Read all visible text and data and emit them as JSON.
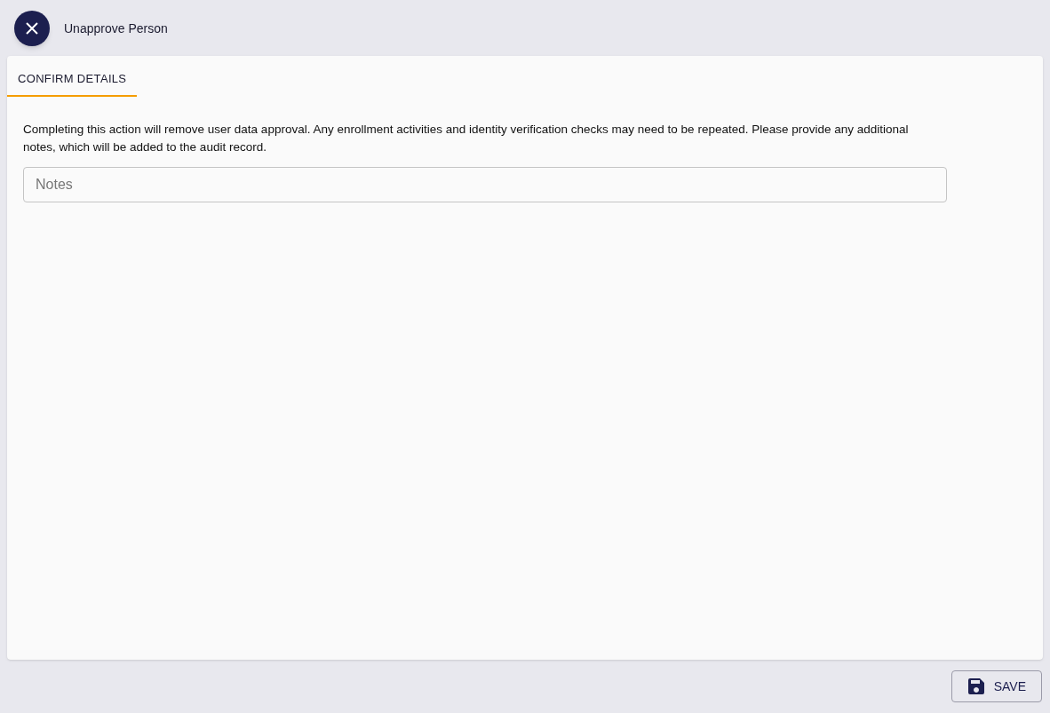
{
  "dialog": {
    "title": "Unapprove Person"
  },
  "tabs": [
    {
      "label": "CONFIRM DETAILS",
      "selected": true
    }
  ],
  "message": "Completing this action will remove user data approval. Any enrollment activities and identity verification checks may need to be repeated. Please provide any additional notes, which will be added to the audit record.",
  "notes_field": {
    "placeholder": "Notes"
  },
  "footer": {
    "save_button": "SAVE"
  }
}
